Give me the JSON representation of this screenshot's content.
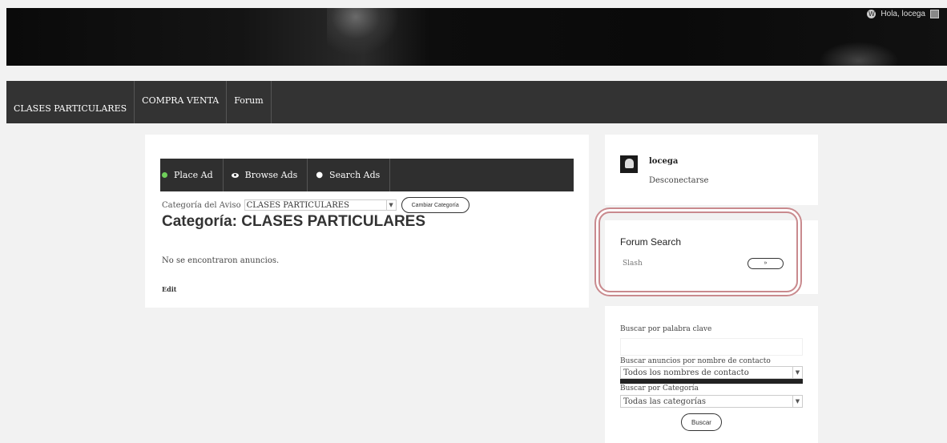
{
  "topbar": {
    "greeting": "Hola, locega"
  },
  "nav": {
    "items": [
      {
        "label": "CLASES PARTICULARES"
      },
      {
        "label": "COMPRA VENTA"
      },
      {
        "label": "Forum"
      }
    ]
  },
  "adbar": {
    "place_ad": "Place Ad",
    "browse_ads": "Browse Ads",
    "search_ads": "Search Ads"
  },
  "category": {
    "label": "Categoría del Aviso",
    "selected": "CLASES PARTICULARES",
    "change_button": "Cambiar Categoría",
    "title": "Categoría: CLASES PARTICULARES",
    "empty_message": "No se encontraron anuncios.",
    "edit_link": "Edit"
  },
  "user_widget": {
    "username": "locega",
    "logout": "Desconectarse"
  },
  "forum_search": {
    "title": "Forum Search",
    "input_value": "Slash",
    "button_label": "»"
  },
  "ad_search": {
    "keyword_label": "Buscar por palabra clave",
    "contact_label": "Buscar anuncios por nombre de contacto",
    "contact_selected": "Todos los nombres de contacto",
    "category_label": "Buscar por Categoría",
    "category_selected": "Todas las categorías",
    "submit": "Buscar"
  },
  "colors": {
    "nav_bg": "#333333",
    "highlight": "#c98a8e",
    "place_ad_dot": "#6fcf5a"
  }
}
